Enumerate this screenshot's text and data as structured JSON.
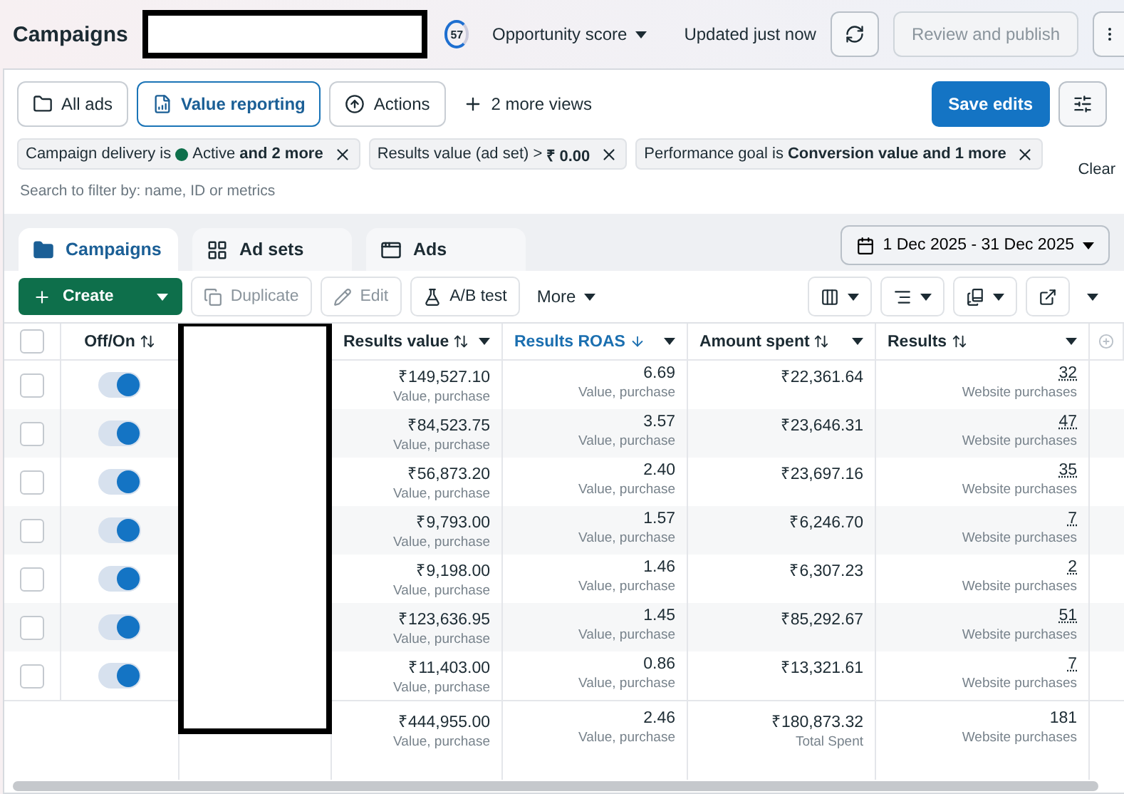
{
  "header": {
    "title": "Campaigns",
    "score": "57",
    "score_label": "Opportunity score",
    "updated": "Updated just now",
    "publish": "Review and publish"
  },
  "views": [
    {
      "label": "All ads",
      "selected": false
    },
    {
      "label": "Value reporting",
      "selected": true
    },
    {
      "label": "Actions",
      "selected": false
    }
  ],
  "more_views": "2 more views",
  "save": "Save edits",
  "filters": [
    {
      "label": "Campaign delivery is",
      "dot": true,
      "value": "Active **and 2 more**"
    },
    {
      "label": "Results value (ad set) >",
      "dot": false,
      "value": "**₹ 0.00**"
    },
    {
      "label": "Performance goal is",
      "dot": false,
      "value": "**Conversion value and 1 more**"
    }
  ],
  "clear": "Clear",
  "search": {
    "placeholder": "Search to filter by: name, ID or metrics"
  },
  "tabs": [
    {
      "label": "Campaigns",
      "selected": true
    },
    {
      "label": "Ad sets",
      "selected": false
    },
    {
      "label": "Ads",
      "selected": false
    }
  ],
  "date": "1 Dec 2025 - 31 Dec 2025",
  "toolbar": {
    "create": "Create",
    "actions": [
      {
        "label": "Duplicate",
        "disabled": true
      },
      {
        "label": "Edit",
        "disabled": true
      },
      {
        "label": "A/B test",
        "disabled": false
      }
    ],
    "more": "More"
  },
  "select_all": {
    "checked": false
  },
  "columns": [
    {
      "label": "Off/On",
      "active": false
    },
    {
      "label": "Results value",
      "active": false
    },
    {
      "label": "Results ROAS",
      "active": true
    },
    {
      "label": "Amount spent",
      "active": false
    },
    {
      "label": "Results",
      "active": false
    }
  ],
  "rows": [
    {
      "checked": false,
      "on": true,
      "value": "₹149,527.10",
      "value_sub": "Value, purchase",
      "roas": "6.69",
      "roas_sub": "Value, purchase",
      "spent": "₹22,361.64",
      "results": "32",
      "results_sub": "Website purchases"
    },
    {
      "checked": false,
      "on": true,
      "value": "₹84,523.75",
      "value_sub": "Value, purchase",
      "roas": "3.57",
      "roas_sub": "Value, purchase",
      "spent": "₹23,646.31",
      "results": "47",
      "results_sub": "Website purchases"
    },
    {
      "checked": false,
      "on": true,
      "value": "₹56,873.20",
      "value_sub": "Value, purchase",
      "roas": "2.40",
      "roas_sub": "Value, purchase",
      "spent": "₹23,697.16",
      "results": "35",
      "results_sub": "Website purchases"
    },
    {
      "checked": false,
      "on": true,
      "value": "₹9,793.00",
      "value_sub": "Value, purchase",
      "roas": "1.57",
      "roas_sub": "Value, purchase",
      "spent": "₹6,246.70",
      "results": "7",
      "results_sub": "Website purchases"
    },
    {
      "checked": false,
      "on": true,
      "value": "₹9,198.00",
      "value_sub": "Value, purchase",
      "roas": "1.46",
      "roas_sub": "Value, purchase",
      "spent": "₹6,307.23",
      "results": "2",
      "results_sub": "Website purchases"
    },
    {
      "checked": false,
      "on": true,
      "value": "₹123,636.95",
      "value_sub": "Value, purchase",
      "roas": "1.45",
      "roas_sub": "Value, purchase",
      "spent": "₹85,292.67",
      "results": "51",
      "results_sub": "Website purchases"
    },
    {
      "checked": false,
      "on": true,
      "value": "₹11,403.00",
      "value_sub": "Value, purchase",
      "roas": "0.86",
      "roas_sub": "Value, purchase",
      "spent": "₹13,321.61",
      "results": "7",
      "results_sub": "Website purchases"
    }
  ],
  "total": {
    "value": "₹444,955.00",
    "value_sub": "Value, purchase",
    "roas": "2.46",
    "roas_sub": "Value, purchase",
    "spent": "₹180,873.32",
    "spent_sub": "Total Spent",
    "results": "181",
    "results_sub": "Website purchases"
  }
}
